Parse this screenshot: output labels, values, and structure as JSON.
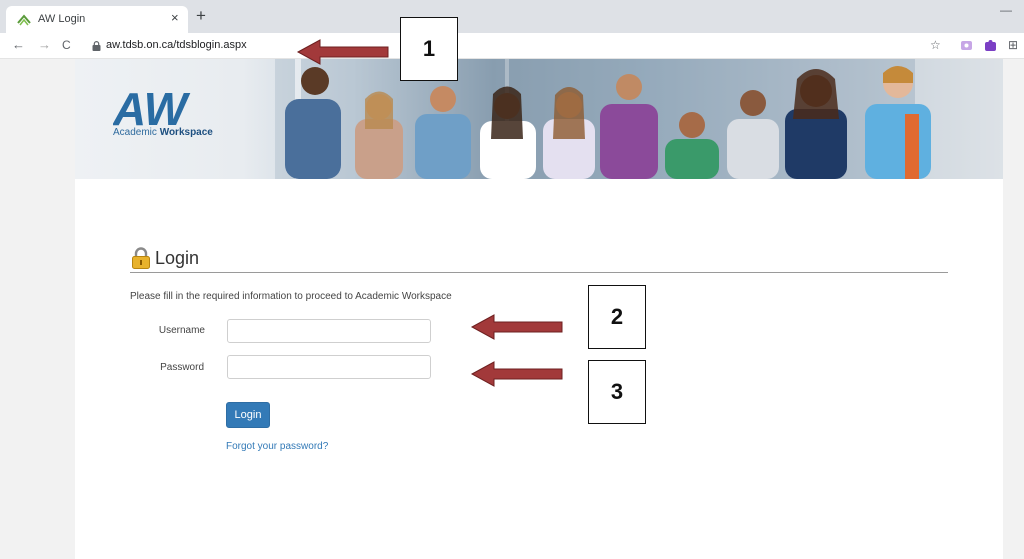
{
  "browser": {
    "tab_title": "AW Login",
    "tab_close": "×",
    "new_tab": "+",
    "url": "aw.tdsb.on.ca/tdsblogin.aspx",
    "back": "←",
    "forward": "→",
    "reload": "C",
    "star": "☆",
    "extensions_icon": "⊞"
  },
  "banner": {
    "logo_text": "AW",
    "sub_regular": "Academic ",
    "sub_bold": "Workspace"
  },
  "login": {
    "title": "Login",
    "instructions": "Please fill in the required information to proceed to Academic Workspace",
    "username_label": "Username",
    "username_value": "",
    "password_label": "Password",
    "password_value": "",
    "submit_label": "Login",
    "forgot_link": "Forgot your password?"
  },
  "annotations": [
    {
      "number": "1"
    },
    {
      "number": "2"
    },
    {
      "number": "3"
    }
  ],
  "colors": {
    "arrow": "#a2393a",
    "button": "#337ab7",
    "link": "#337ab7"
  }
}
